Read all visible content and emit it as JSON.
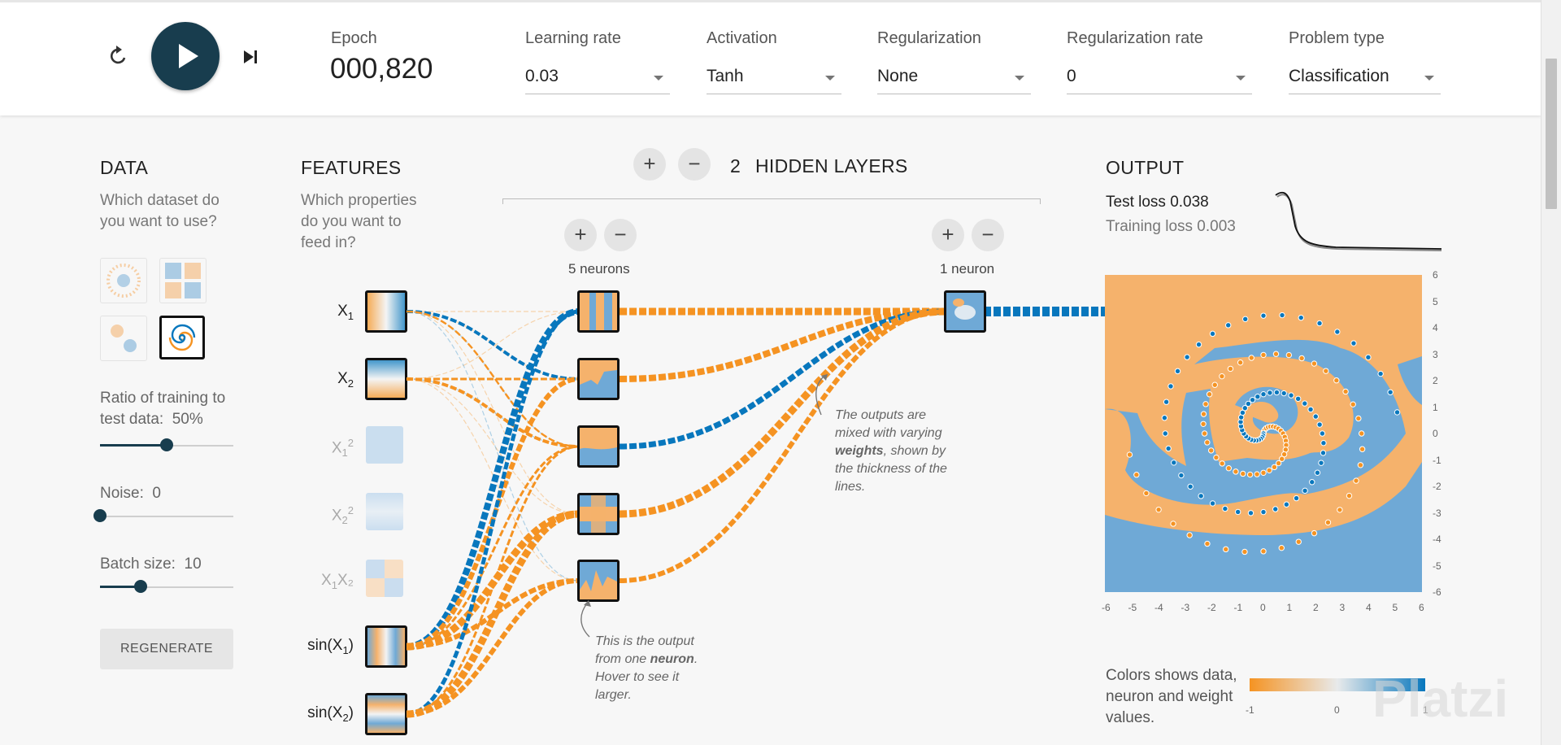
{
  "controls": {
    "epoch_label": "Epoch",
    "epoch_value": "000,820",
    "learning_rate": {
      "label": "Learning rate",
      "value": "0.03"
    },
    "activation": {
      "label": "Activation",
      "value": "Tanh"
    },
    "regularization": {
      "label": "Regularization",
      "value": "None"
    },
    "regularization_rate": {
      "label": "Regularization rate",
      "value": "0"
    },
    "problem_type": {
      "label": "Problem type",
      "value": "Classification"
    }
  },
  "data_panel": {
    "heading": "DATA",
    "subtitle": "Which dataset do you want to use?",
    "ratio_label": "Ratio of training to test data:",
    "ratio_value": "50%",
    "ratio_fraction": 0.5,
    "noise_label": "Noise:",
    "noise_value": "0",
    "noise_fraction": 0.0,
    "batch_label": "Batch size:",
    "batch_value": "10",
    "batch_fraction": 0.3,
    "regenerate_label": "REGENERATE",
    "selected_dataset": "spiral"
  },
  "features_panel": {
    "heading": "FEATURES",
    "subtitle": "Which properties do you want to feed in?",
    "features": [
      {
        "main": "X",
        "sub": "1",
        "sup": "",
        "tail": "",
        "active": true
      },
      {
        "main": "X",
        "sub": "2",
        "sup": "",
        "tail": "",
        "active": true
      },
      {
        "main": "X",
        "sub": "1",
        "sup": "2",
        "tail": "",
        "active": false
      },
      {
        "main": "X",
        "sub": "2",
        "sup": "2",
        "tail": "",
        "active": false
      },
      {
        "main": "X",
        "sub": "1",
        "sup": "",
        "tail": "X₂",
        "active": false
      },
      {
        "main": "sin(X",
        "sub": "1",
        "sup": "",
        "tail": ")",
        "active": true
      },
      {
        "main": "sin(X",
        "sub": "2",
        "sup": "",
        "tail": ")",
        "active": true
      }
    ]
  },
  "network": {
    "hidden_layers_count": "2",
    "hidden_layers_label": "HIDDEN LAYERS",
    "add_layer": "+",
    "remove_layer": "−",
    "layer1_label": "5 neurons",
    "layer2_label": "1 neuron",
    "add_neuron": "+",
    "remove_neuron": "−",
    "note_weights_1": "The outputs are mixed with varying",
    "note_weights_bold": "weights",
    "note_weights_2": ", shown by the thickness of the lines.",
    "note_neuron_1": "This is the output from one",
    "note_neuron_bold": "neuron",
    "note_neuron_2": ". Hover to see it larger."
  },
  "output_panel": {
    "heading": "OUTPUT",
    "test_loss": "Test loss 0.038",
    "training_loss": "Training loss 0.003",
    "x_ticks": [
      "-6",
      "-5",
      "-4",
      "-3",
      "-2",
      "-1",
      "0",
      "1",
      "2",
      "3",
      "4",
      "5",
      "6"
    ],
    "y_ticks": [
      "6",
      "5",
      "4",
      "3",
      "2",
      "1",
      "0",
      "-1",
      "-2",
      "-3",
      "-4",
      "-5",
      "-6"
    ],
    "legend_text": "Colors shows data, neuron and weight values.",
    "legend_ticks": [
      "-1",
      "0",
      "1"
    ]
  },
  "watermark": "Platzi",
  "colors": {
    "orange": "#f59322",
    "blue": "#0877bd",
    "bg_orange": "#f5b26c",
    "bg_blue": "#6fa9d6",
    "dark": "#183d4e"
  }
}
